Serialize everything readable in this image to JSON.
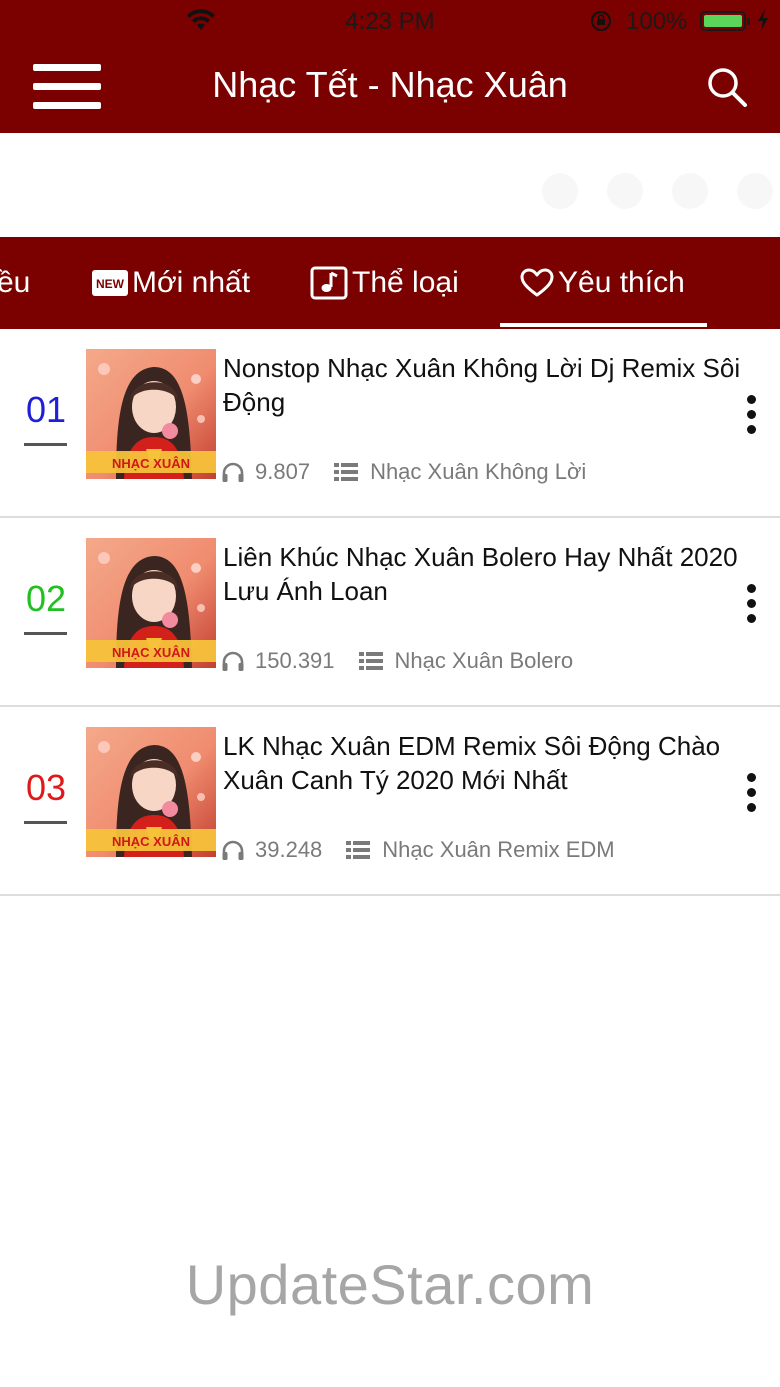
{
  "status_bar": {
    "time": "4:23 PM",
    "battery_percent": "100%",
    "battery_level": 1.0,
    "icons": [
      "wifi-icon",
      "orientation-lock-icon",
      "battery-icon",
      "charging-bolt-icon"
    ]
  },
  "header": {
    "title": "Nhạc Tết - Nhạc Xuân",
    "menu_icon": "hamburger-menu-icon",
    "search_icon": "search-icon"
  },
  "tabs": [
    {
      "label": "ều",
      "icon": ""
    },
    {
      "label": "Mới nhất",
      "icon": "new-badge-icon",
      "badge_text": "NEW"
    },
    {
      "label": "Thể loại",
      "icon": "music-note-icon"
    },
    {
      "label": "Yêu thích",
      "icon": "heart-icon",
      "selected": true
    }
  ],
  "songs": [
    {
      "rank": "01",
      "rank_color": "#1f1fd8",
      "title": "Nonstop Nhạc Xuân Không Lời Dj Remix Sôi Động",
      "listens": "9.807",
      "category": "Nhạc Xuân Không Lời",
      "thumb_caption": "NHẠC XUÂN"
    },
    {
      "rank": "02",
      "rank_color": "#20c020",
      "title": "Liên Khúc Nhạc Xuân Bolero Hay Nhất 2020 Lưu Ánh Loan",
      "listens": "150.391",
      "category": "Nhạc Xuân Bolero",
      "thumb_caption": "NHẠC XUÂN"
    },
    {
      "rank": "03",
      "rank_color": "#e01818",
      "title": "LK Nhạc Xuân EDM Remix Sôi Động Chào Xuân Canh Tý 2020 Mới Nhất",
      "listens": "39.248",
      "category": "Nhạc Xuân Remix EDM",
      "thumb_caption": "NHẠC XUÂN"
    }
  ],
  "watermark": "UpdateStar.com",
  "colors": {
    "brand": "#7b0000",
    "meta_text": "#7a7a7a",
    "divider": "#dddddd"
  }
}
